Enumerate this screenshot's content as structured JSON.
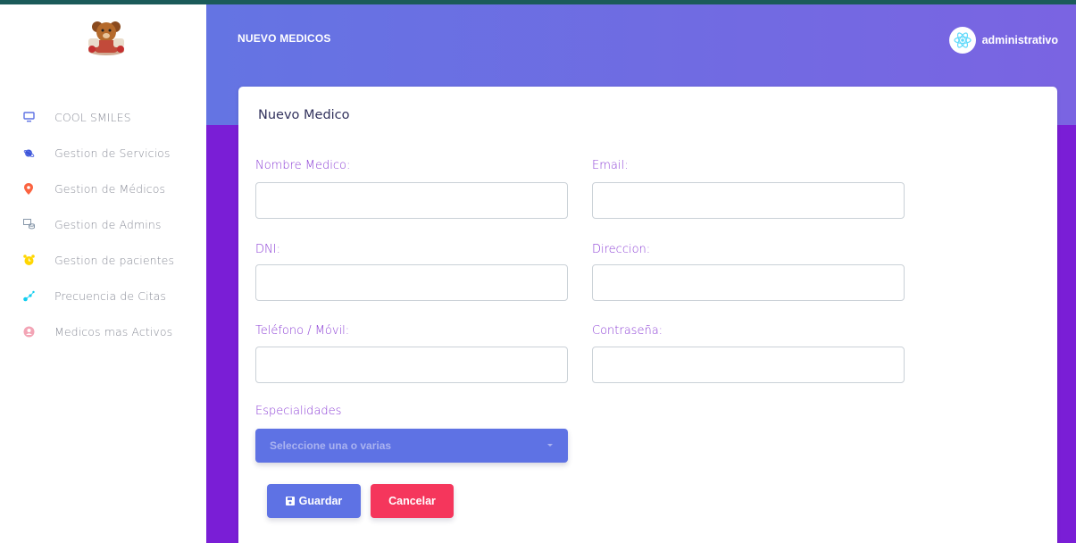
{
  "header": {
    "title": "NUEVO MEDICOS",
    "user_name": "administrativo"
  },
  "sidebar": {
    "items": [
      {
        "label": "COOL SMILES",
        "icon": "monitor-icon",
        "color": "#5e72e4"
      },
      {
        "label": "Gestion de Servicios",
        "icon": "planet-icon",
        "color": "#5e72e4"
      },
      {
        "label": "Gestion de Médicos",
        "icon": "pin-icon",
        "color": "#fb6340"
      },
      {
        "label": "Gestion de Admins",
        "icon": "admin-icon",
        "color": "#8898aa"
      },
      {
        "label": "Gestion de pacientes",
        "icon": "alarm-icon",
        "color": "#ffd600"
      },
      {
        "label": "Precuencia de Citas",
        "icon": "chart-icon",
        "color": "#11cdef"
      },
      {
        "label": "Medicos mas Activos",
        "icon": "user-icon",
        "color": "#f3a4b5"
      }
    ]
  },
  "form": {
    "title": "Nuevo Medico",
    "fields": {
      "nombre": {
        "label": "Nombre Medico:",
        "value": ""
      },
      "email": {
        "label": "Email:",
        "value": ""
      },
      "dni": {
        "label": "DNI:",
        "value": ""
      },
      "direccion": {
        "label": "Direccion:",
        "value": ""
      },
      "telefono": {
        "label": "Teléfono / Móvil:",
        "value": ""
      },
      "password": {
        "label": "Contraseña:",
        "value": ""
      }
    },
    "especialidades": {
      "label": "Especialidades",
      "placeholder": "Seleccione una o varias"
    },
    "save_label": "Guardar",
    "cancel_label": "Cancelar"
  },
  "colors": {
    "primary": "#5e72e4",
    "danger": "#f5365c",
    "label": "#8c3fd6",
    "background": "#7a1ed6"
  }
}
